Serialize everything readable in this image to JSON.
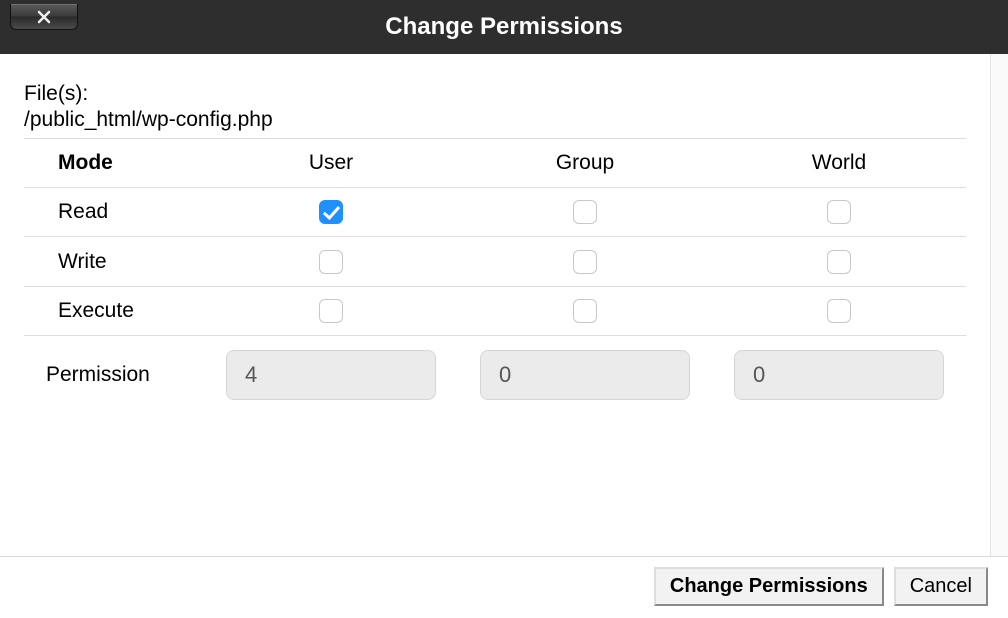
{
  "title": "Change Permissions",
  "files_label": "File(s):",
  "file_path": "/public_html/wp-config.php",
  "headers": {
    "mode": "Mode",
    "user": "User",
    "group": "Group",
    "world": "World"
  },
  "rows": {
    "read": {
      "label": "Read",
      "user": true,
      "group": false,
      "world": false
    },
    "write": {
      "label": "Write",
      "user": false,
      "group": false,
      "world": false
    },
    "execute": {
      "label": "Execute",
      "user": false,
      "group": false,
      "world": false
    }
  },
  "permission_label": "Permission",
  "permission_values": {
    "user": "4",
    "group": "0",
    "world": "0"
  },
  "buttons": {
    "change": "Change Permissions",
    "cancel": "Cancel"
  }
}
